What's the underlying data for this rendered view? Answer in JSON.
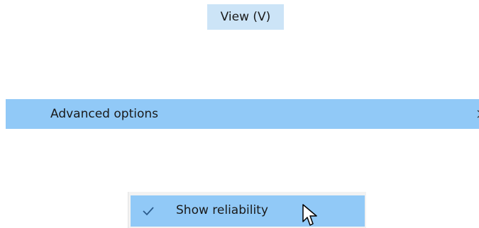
{
  "menu": {
    "view_label": "View (V)"
  },
  "advanced": {
    "label": "Advanced options",
    "chevron_icon": "chevron-right-icon"
  },
  "reliability": {
    "label": "Show reliability",
    "checked": true,
    "check_icon": "checkmark-icon"
  },
  "colors": {
    "hover_highlight": "#91c9f7",
    "menu_highlight": "#cce4f7",
    "check_color": "#2b5b8c"
  }
}
